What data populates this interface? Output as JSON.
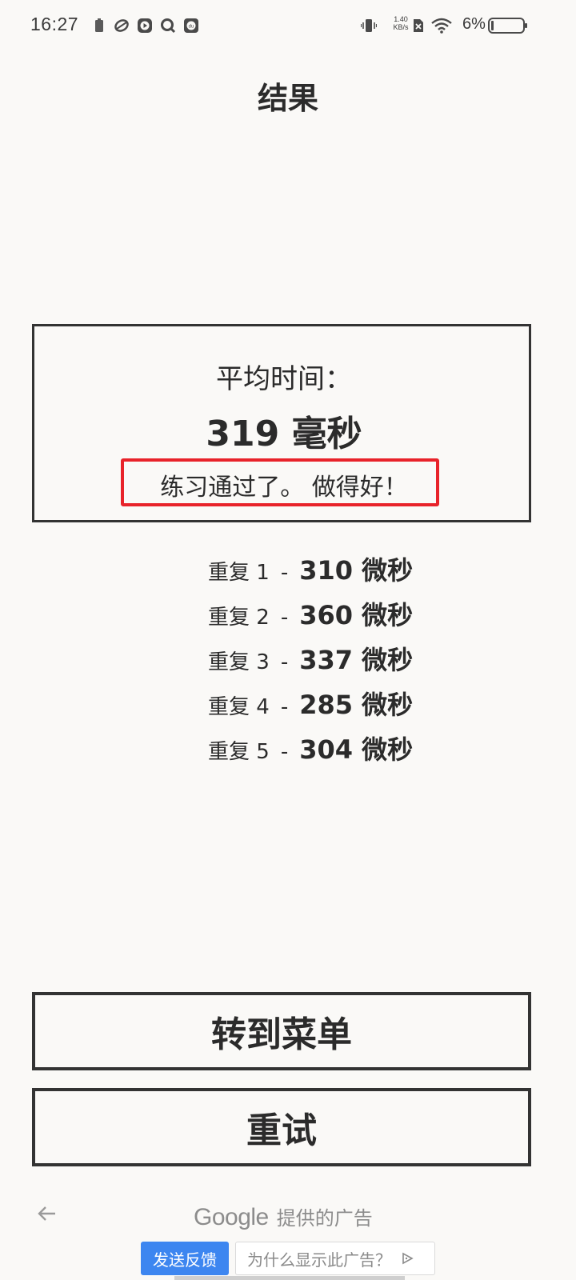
{
  "status_bar": {
    "time": "16:27",
    "net_speed_value": "1.40",
    "net_speed_unit": "KB/s",
    "battery_percent": "6%"
  },
  "page": {
    "title": "结果"
  },
  "result": {
    "avg_label": "平均时间：",
    "avg_value": "319 毫秒",
    "feedback": "练习通过了。 做得好！"
  },
  "repetitions": [
    {
      "label": "重复 1",
      "value": "310 微秒"
    },
    {
      "label": "重复 2",
      "value": "360 微秒"
    },
    {
      "label": "重复 3",
      "value": "337 微秒"
    },
    {
      "label": "重复 4",
      "value": "285 微秒"
    },
    {
      "label": "重复 5",
      "value": "304 微秒"
    }
  ],
  "rep_separator": "-",
  "buttons": {
    "menu": "转到菜单",
    "retry": "重试"
  },
  "ad": {
    "brand": "Google",
    "provided_text": "提供的广告",
    "feedback_button": "发送反馈",
    "why_button": "为什么显示此广告？"
  },
  "colors": {
    "background": "#faf9f7",
    "text": "#2b2b2b",
    "highlight": "#e8232a",
    "ad_blue": "#3d86f0"
  }
}
